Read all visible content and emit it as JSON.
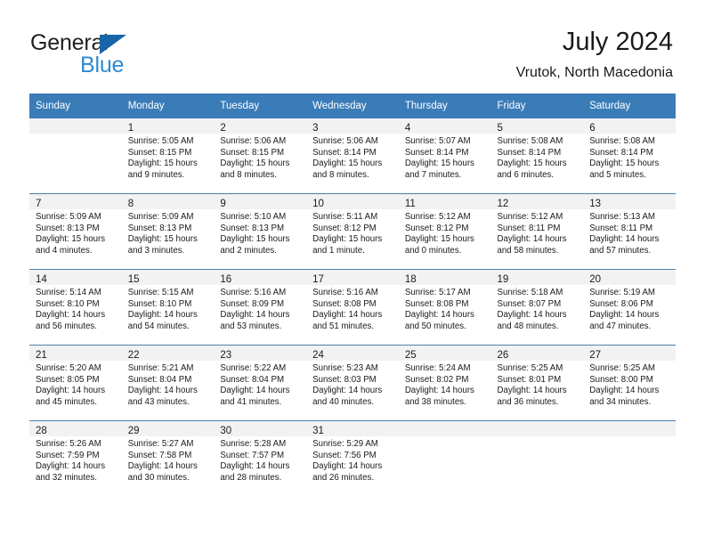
{
  "brand": {
    "name_part1": "General",
    "name_part2": "Blue",
    "accent_color": "#1565a8",
    "accent_color_light": "#2e8bd0"
  },
  "header": {
    "title": "July 2024",
    "subtitle": "Vrutok, North Macedonia"
  },
  "calendar": {
    "header_bg": "#3a7cb8",
    "daynum_bg": "#f2f2f2",
    "weekday_headers": [
      "Sunday",
      "Monday",
      "Tuesday",
      "Wednesday",
      "Thursday",
      "Friday",
      "Saturday"
    ],
    "weeks": [
      [
        {
          "day": "",
          "lines": []
        },
        {
          "day": "1",
          "lines": [
            "Sunrise: 5:05 AM",
            "Sunset: 8:15 PM",
            "Daylight: 15 hours",
            "and 9 minutes."
          ]
        },
        {
          "day": "2",
          "lines": [
            "Sunrise: 5:06 AM",
            "Sunset: 8:15 PM",
            "Daylight: 15 hours",
            "and 8 minutes."
          ]
        },
        {
          "day": "3",
          "lines": [
            "Sunrise: 5:06 AM",
            "Sunset: 8:14 PM",
            "Daylight: 15 hours",
            "and 8 minutes."
          ]
        },
        {
          "day": "4",
          "lines": [
            "Sunrise: 5:07 AM",
            "Sunset: 8:14 PM",
            "Daylight: 15 hours",
            "and 7 minutes."
          ]
        },
        {
          "day": "5",
          "lines": [
            "Sunrise: 5:08 AM",
            "Sunset: 8:14 PM",
            "Daylight: 15 hours",
            "and 6 minutes."
          ]
        },
        {
          "day": "6",
          "lines": [
            "Sunrise: 5:08 AM",
            "Sunset: 8:14 PM",
            "Daylight: 15 hours",
            "and 5 minutes."
          ]
        }
      ],
      [
        {
          "day": "7",
          "lines": [
            "Sunrise: 5:09 AM",
            "Sunset: 8:13 PM",
            "Daylight: 15 hours",
            "and 4 minutes."
          ]
        },
        {
          "day": "8",
          "lines": [
            "Sunrise: 5:09 AM",
            "Sunset: 8:13 PM",
            "Daylight: 15 hours",
            "and 3 minutes."
          ]
        },
        {
          "day": "9",
          "lines": [
            "Sunrise: 5:10 AM",
            "Sunset: 8:13 PM",
            "Daylight: 15 hours",
            "and 2 minutes."
          ]
        },
        {
          "day": "10",
          "lines": [
            "Sunrise: 5:11 AM",
            "Sunset: 8:12 PM",
            "Daylight: 15 hours",
            "and 1 minute."
          ]
        },
        {
          "day": "11",
          "lines": [
            "Sunrise: 5:12 AM",
            "Sunset: 8:12 PM",
            "Daylight: 15 hours",
            "and 0 minutes."
          ]
        },
        {
          "day": "12",
          "lines": [
            "Sunrise: 5:12 AM",
            "Sunset: 8:11 PM",
            "Daylight: 14 hours",
            "and 58 minutes."
          ]
        },
        {
          "day": "13",
          "lines": [
            "Sunrise: 5:13 AM",
            "Sunset: 8:11 PM",
            "Daylight: 14 hours",
            "and 57 minutes."
          ]
        }
      ],
      [
        {
          "day": "14",
          "lines": [
            "Sunrise: 5:14 AM",
            "Sunset: 8:10 PM",
            "Daylight: 14 hours",
            "and 56 minutes."
          ]
        },
        {
          "day": "15",
          "lines": [
            "Sunrise: 5:15 AM",
            "Sunset: 8:10 PM",
            "Daylight: 14 hours",
            "and 54 minutes."
          ]
        },
        {
          "day": "16",
          "lines": [
            "Sunrise: 5:16 AM",
            "Sunset: 8:09 PM",
            "Daylight: 14 hours",
            "and 53 minutes."
          ]
        },
        {
          "day": "17",
          "lines": [
            "Sunrise: 5:16 AM",
            "Sunset: 8:08 PM",
            "Daylight: 14 hours",
            "and 51 minutes."
          ]
        },
        {
          "day": "18",
          "lines": [
            "Sunrise: 5:17 AM",
            "Sunset: 8:08 PM",
            "Daylight: 14 hours",
            "and 50 minutes."
          ]
        },
        {
          "day": "19",
          "lines": [
            "Sunrise: 5:18 AM",
            "Sunset: 8:07 PM",
            "Daylight: 14 hours",
            "and 48 minutes."
          ]
        },
        {
          "day": "20",
          "lines": [
            "Sunrise: 5:19 AM",
            "Sunset: 8:06 PM",
            "Daylight: 14 hours",
            "and 47 minutes."
          ]
        }
      ],
      [
        {
          "day": "21",
          "lines": [
            "Sunrise: 5:20 AM",
            "Sunset: 8:05 PM",
            "Daylight: 14 hours",
            "and 45 minutes."
          ]
        },
        {
          "day": "22",
          "lines": [
            "Sunrise: 5:21 AM",
            "Sunset: 8:04 PM",
            "Daylight: 14 hours",
            "and 43 minutes."
          ]
        },
        {
          "day": "23",
          "lines": [
            "Sunrise: 5:22 AM",
            "Sunset: 8:04 PM",
            "Daylight: 14 hours",
            "and 41 minutes."
          ]
        },
        {
          "day": "24",
          "lines": [
            "Sunrise: 5:23 AM",
            "Sunset: 8:03 PM",
            "Daylight: 14 hours",
            "and 40 minutes."
          ]
        },
        {
          "day": "25",
          "lines": [
            "Sunrise: 5:24 AM",
            "Sunset: 8:02 PM",
            "Daylight: 14 hours",
            "and 38 minutes."
          ]
        },
        {
          "day": "26",
          "lines": [
            "Sunrise: 5:25 AM",
            "Sunset: 8:01 PM",
            "Daylight: 14 hours",
            "and 36 minutes."
          ]
        },
        {
          "day": "27",
          "lines": [
            "Sunrise: 5:25 AM",
            "Sunset: 8:00 PM",
            "Daylight: 14 hours",
            "and 34 minutes."
          ]
        }
      ],
      [
        {
          "day": "28",
          "lines": [
            "Sunrise: 5:26 AM",
            "Sunset: 7:59 PM",
            "Daylight: 14 hours",
            "and 32 minutes."
          ]
        },
        {
          "day": "29",
          "lines": [
            "Sunrise: 5:27 AM",
            "Sunset: 7:58 PM",
            "Daylight: 14 hours",
            "and 30 minutes."
          ]
        },
        {
          "day": "30",
          "lines": [
            "Sunrise: 5:28 AM",
            "Sunset: 7:57 PM",
            "Daylight: 14 hours",
            "and 28 minutes."
          ]
        },
        {
          "day": "31",
          "lines": [
            "Sunrise: 5:29 AM",
            "Sunset: 7:56 PM",
            "Daylight: 14 hours",
            "and 26 minutes."
          ]
        },
        {
          "day": "",
          "lines": []
        },
        {
          "day": "",
          "lines": []
        },
        {
          "day": "",
          "lines": []
        }
      ]
    ]
  }
}
